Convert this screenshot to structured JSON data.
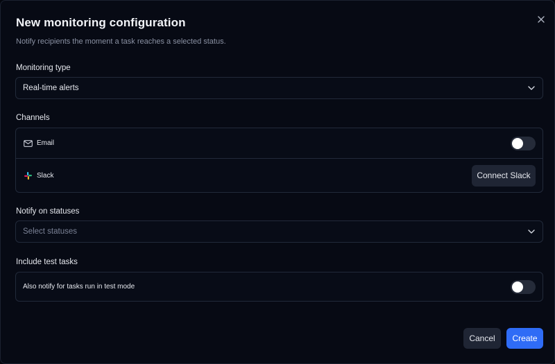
{
  "dialog": {
    "title": "New monitoring configuration",
    "subtitle": "Notify recipients the moment a task reaches a selected status.",
    "close_icon": "close-icon"
  },
  "monitoring_type": {
    "label": "Monitoring type",
    "value": "Real-time alerts",
    "icon": "chevron-down-icon"
  },
  "channels": {
    "label": "Channels",
    "email": {
      "label": "Email",
      "icon": "mail-icon",
      "enabled": false
    },
    "slack": {
      "label": "Slack",
      "icon": "slack-icon",
      "button_label": "Connect Slack"
    }
  },
  "statuses": {
    "label": "Notify on statuses",
    "placeholder": "Select statuses",
    "icon": "chevron-down-icon"
  },
  "test_tasks": {
    "label": "Include test tasks",
    "option_label": "Also notify for tasks run in test mode",
    "enabled": false
  },
  "footer": {
    "cancel_label": "Cancel",
    "create_label": "Create"
  },
  "colors": {
    "background": "#070a14",
    "border": "#222a3a",
    "primary": "#2f6cf6",
    "secondary_button": "#1f2534",
    "toggle_off": "#252b39"
  }
}
